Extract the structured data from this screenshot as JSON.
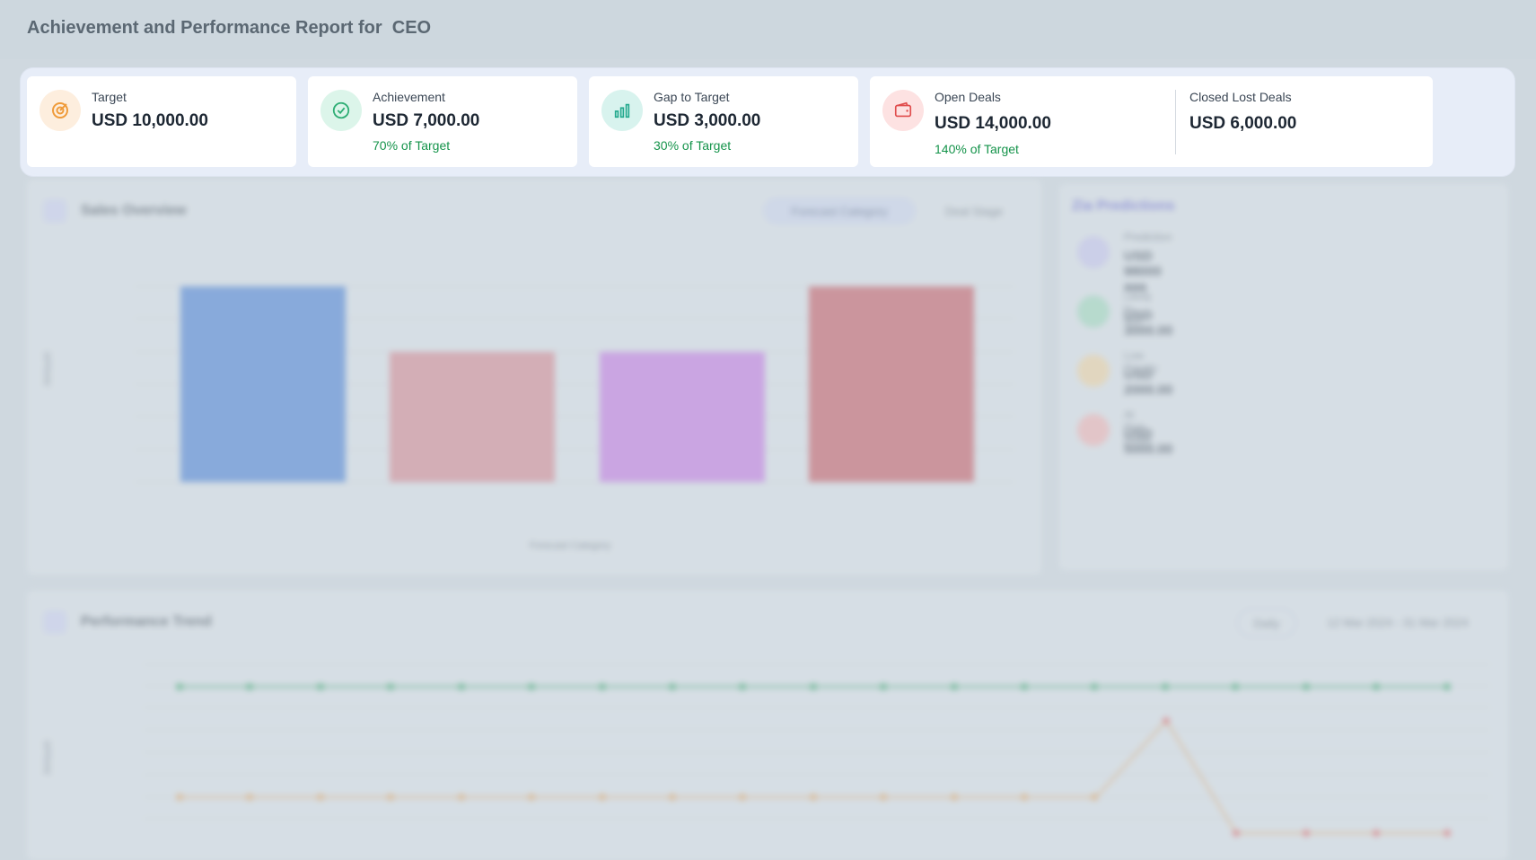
{
  "page": {
    "title": "Achievement and Performance Report for  CEO"
  },
  "kpis": {
    "target": {
      "label": "Target",
      "value": "USD 10,000.00"
    },
    "achievement": {
      "label": "Achievement",
      "value": "USD 7,000.00",
      "sub": "70% of Target"
    },
    "gap": {
      "label": "Gap to Target",
      "value": "USD 3,000.00",
      "sub": "30% of Target"
    },
    "open_deals": {
      "label": "Open Deals",
      "value": "USD 14,000.00",
      "sub": "140% of Target"
    },
    "closed_lost": {
      "label": "Closed Lost Deals",
      "value": "USD 6,000.00"
    }
  },
  "sales_overview": {
    "title": "Sales Overview",
    "tabs": [
      "Forecast Category",
      "Deal Stage"
    ],
    "xlabel": "Forecast Category",
    "ylabel": "Amount",
    "bar_colors": [
      "#4f86d8",
      "#d88c95",
      "#c77de6",
      "#c96068"
    ]
  },
  "zia": {
    "title": "Zia Predictions",
    "items": [
      {
        "label": "Prediction",
        "value": "USD 98000 aaa",
        "color": "#b9b8ee"
      },
      {
        "label": "Likely to Win",
        "value": "USD 3000.00",
        "color": "#a4dcc0"
      },
      {
        "label": "Low Priority",
        "value": "USD 2000.00",
        "color": "#f1d6a6"
      },
      {
        "label": "At Risk Deals",
        "value": "USD 5000.00",
        "color": "#f3b7b7"
      }
    ]
  },
  "performance_trend": {
    "title": "Performance Trend",
    "period": "Daily",
    "range": "12 Mar 2024 - 31 Mar 2024",
    "ylabel": "Amount",
    "colors": {
      "target": "#3aa76d",
      "achievement": "#e3a868",
      "spike": "#e06a6a"
    }
  }
}
